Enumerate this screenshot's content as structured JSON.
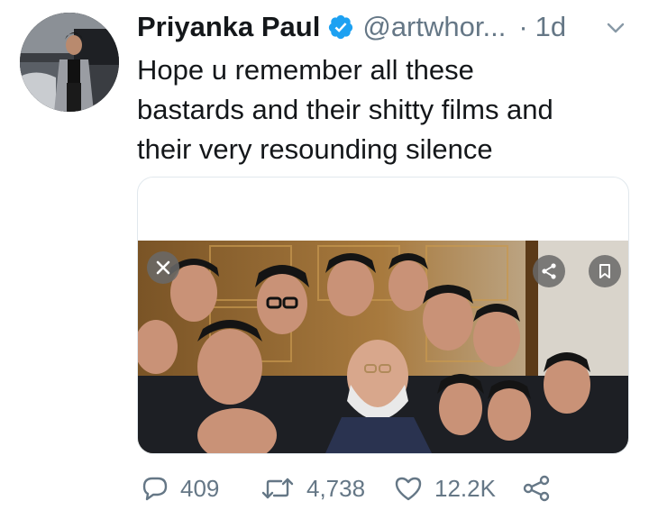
{
  "tweet": {
    "author_name": "Priyanka Paul",
    "handle": "@artwhor...",
    "separator": "·",
    "time": "1d",
    "text": "Hope u remember all these\nbastards and their shitty films and\ntheir very resounding silence",
    "verified": true
  },
  "actions": {
    "reply_count": "409",
    "retweet_count": "4,738",
    "like_count": "12.2K"
  },
  "icons": {
    "verified": "verified-badge-icon",
    "menu": "chevron-down-icon",
    "reply": "reply-icon",
    "retweet": "retweet-icon",
    "like": "heart-icon",
    "share": "share-icon",
    "photo_close": "close-icon",
    "photo_share": "share-icon",
    "photo_bookmark": "bookmark-icon"
  },
  "colors": {
    "text": "#14171a",
    "secondary": "#657786",
    "verified_blue": "#1da1f2",
    "card_border": "#e1e8ed"
  }
}
